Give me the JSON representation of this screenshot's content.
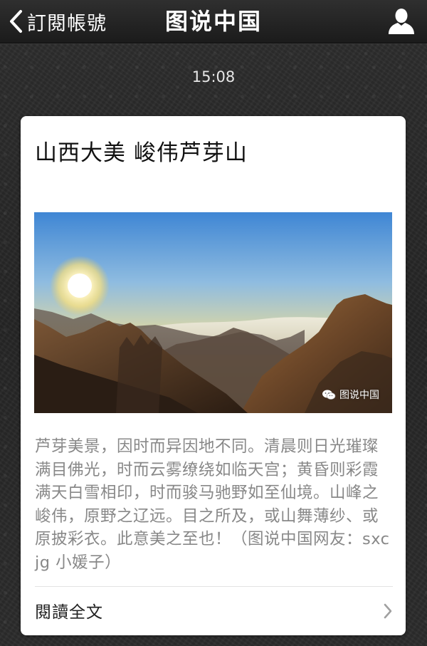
{
  "navbar": {
    "back_label": "訂閱帳號",
    "title": "图说中国",
    "back_icon": "chevron-left-icon",
    "profile_icon": "person-icon"
  },
  "timestamp": "15:08",
  "article": {
    "title": "山西大美 峻伟芦芽山",
    "cover_watermark": "图说中国",
    "summary": "芦芽美景，因时而异因地不同。清晨则日光璀璨满目佛光，时而云雾缭绕如临天宫；黄昏则彩霞满天白雪相印，时而骏马驰野如至仙境。山峰之峻伟，原野之辽远。目之所及，或山舞薄纱、或原披彩衣。此意美之至也！（图说中国网友：sxcjg 小媛子）",
    "read_more_label": "閱讀全文",
    "read_more_icon": "chevron-right-icon"
  },
  "colors": {
    "navbar": "#1f1f1f",
    "card": "#ffffff",
    "summary_text": "#888888",
    "title_text": "#111111"
  }
}
